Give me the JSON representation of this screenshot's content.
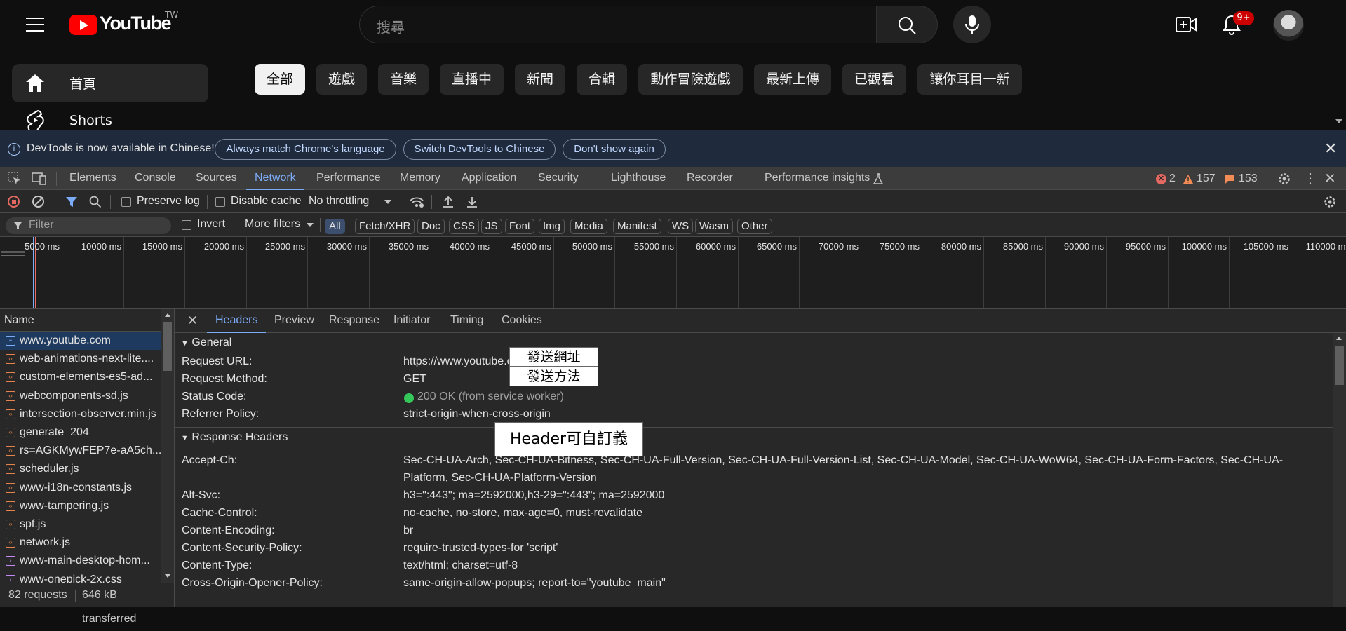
{
  "youtube": {
    "logo_text": "YouTube",
    "region": "TW",
    "search_placeholder": "搜尋",
    "notifications_badge": "9+",
    "sidebar": [
      {
        "label": "首頁",
        "icon": "home-icon",
        "active": true
      },
      {
        "label": "Shorts",
        "icon": "shorts-icon",
        "active": false
      }
    ],
    "chips": [
      "全部",
      "遊戲",
      "音樂",
      "直播中",
      "新聞",
      "合輯",
      "動作冒險遊戲",
      "最新上傳",
      "已觀看",
      "讓你耳目一新"
    ]
  },
  "devtools": {
    "infobar": {
      "message": "DevTools is now available in Chinese!",
      "btn_match": "Always match Chrome's language",
      "btn_switch": "Switch DevTools to Chinese",
      "btn_dont_show": "Don't show again"
    },
    "tabs": [
      "Elements",
      "Console",
      "Sources",
      "Network",
      "Performance",
      "Memory",
      "Application",
      "Security",
      "Lighthouse",
      "Recorder",
      "Performance insights"
    ],
    "active_tab": "Network",
    "counts": {
      "errors": "2",
      "warnings": "157",
      "issues": "153"
    },
    "toolbar": {
      "preserve_log": "Preserve log",
      "disable_cache": "Disable cache",
      "throttling": "No throttling"
    },
    "filterbar": {
      "filter_placeholder": "Filter",
      "invert": "Invert",
      "more_filters": "More filters",
      "types": [
        "All",
        "Fetch/XHR",
        "Doc",
        "CSS",
        "JS",
        "Font",
        "Img",
        "Media",
        "Manifest",
        "WS",
        "Wasm",
        "Other"
      ]
    },
    "timeline_ticks": [
      "5000 ms",
      "10000 ms",
      "15000 ms",
      "20000 ms",
      "25000 ms",
      "30000 ms",
      "35000 ms",
      "40000 ms",
      "45000 ms",
      "50000 ms",
      "55000 ms",
      "60000 ms",
      "65000 ms",
      "70000 ms",
      "75000 ms",
      "80000 ms",
      "85000 ms",
      "90000 ms",
      "95000 ms",
      "100000 ms",
      "105000 ms",
      "110000 ms"
    ],
    "name_header": "Name",
    "requests": [
      {
        "name": "www.youtube.com",
        "type": "doc",
        "selected": true
      },
      {
        "name": "web-animations-next-lite....",
        "type": "script"
      },
      {
        "name": "custom-elements-es5-ad...",
        "type": "script"
      },
      {
        "name": "webcomponents-sd.js",
        "type": "script"
      },
      {
        "name": "intersection-observer.min.js",
        "type": "script"
      },
      {
        "name": "generate_204",
        "type": "script"
      },
      {
        "name": "rs=AGKMywFEP7e-aA5ch...",
        "type": "script"
      },
      {
        "name": "scheduler.js",
        "type": "script"
      },
      {
        "name": "www-i18n-constants.js",
        "type": "script"
      },
      {
        "name": "www-tampering.js",
        "type": "script"
      },
      {
        "name": "spf.js",
        "type": "script"
      },
      {
        "name": "network.js",
        "type": "script"
      },
      {
        "name": "www-main-desktop-hom...",
        "type": "css"
      },
      {
        "name": "www-onepick-2x.css",
        "type": "css"
      }
    ],
    "status": {
      "requests": "82 requests",
      "transferred": "646 kB transferred"
    },
    "detail_tabs": [
      "Headers",
      "Preview",
      "Response",
      "Initiator",
      "Timing",
      "Cookies"
    ],
    "general": {
      "title": "General",
      "rows": [
        {
          "key": "Request URL:",
          "value": "https://www.youtube.com/"
        },
        {
          "key": "Request Method:",
          "value": "GET"
        },
        {
          "key": "Status Code:",
          "value": "200 OK (from service worker)"
        },
        {
          "key": "Referrer Policy:",
          "value": "strict-origin-when-cross-origin"
        }
      ]
    },
    "response_headers": {
      "title": "Response Headers",
      "rows": [
        {
          "key": "Accept-Ch:",
          "value": "Sec-CH-UA-Arch, Sec-CH-UA-Bitness, Sec-CH-UA-Full-Version, Sec-CH-UA-Full-Version-List, Sec-CH-UA-Model, Sec-CH-UA-WoW64, Sec-CH-UA-Form-Factors, Sec-CH-UA-",
          "value2": "Platform, Sec-CH-UA-Platform-Version"
        },
        {
          "key": "Alt-Svc:",
          "value": "h3=\":443\"; ma=2592000,h3-29=\":443\"; ma=2592000"
        },
        {
          "key": "Cache-Control:",
          "value": "no-cache, no-store, max-age=0, must-revalidate"
        },
        {
          "key": "Content-Encoding:",
          "value": "br"
        },
        {
          "key": "Content-Security-Policy:",
          "value": "require-trusted-types-for 'script'"
        },
        {
          "key": "Content-Type:",
          "value": "text/html; charset=utf-8"
        },
        {
          "key": "Cross-Origin-Opener-Policy:",
          "value": "same-origin-allow-popups; report-to=\"youtube_main\""
        }
      ]
    },
    "annotations": {
      "url": "發送網址",
      "method": "發送方法",
      "header": "Header可自訂義"
    }
  }
}
